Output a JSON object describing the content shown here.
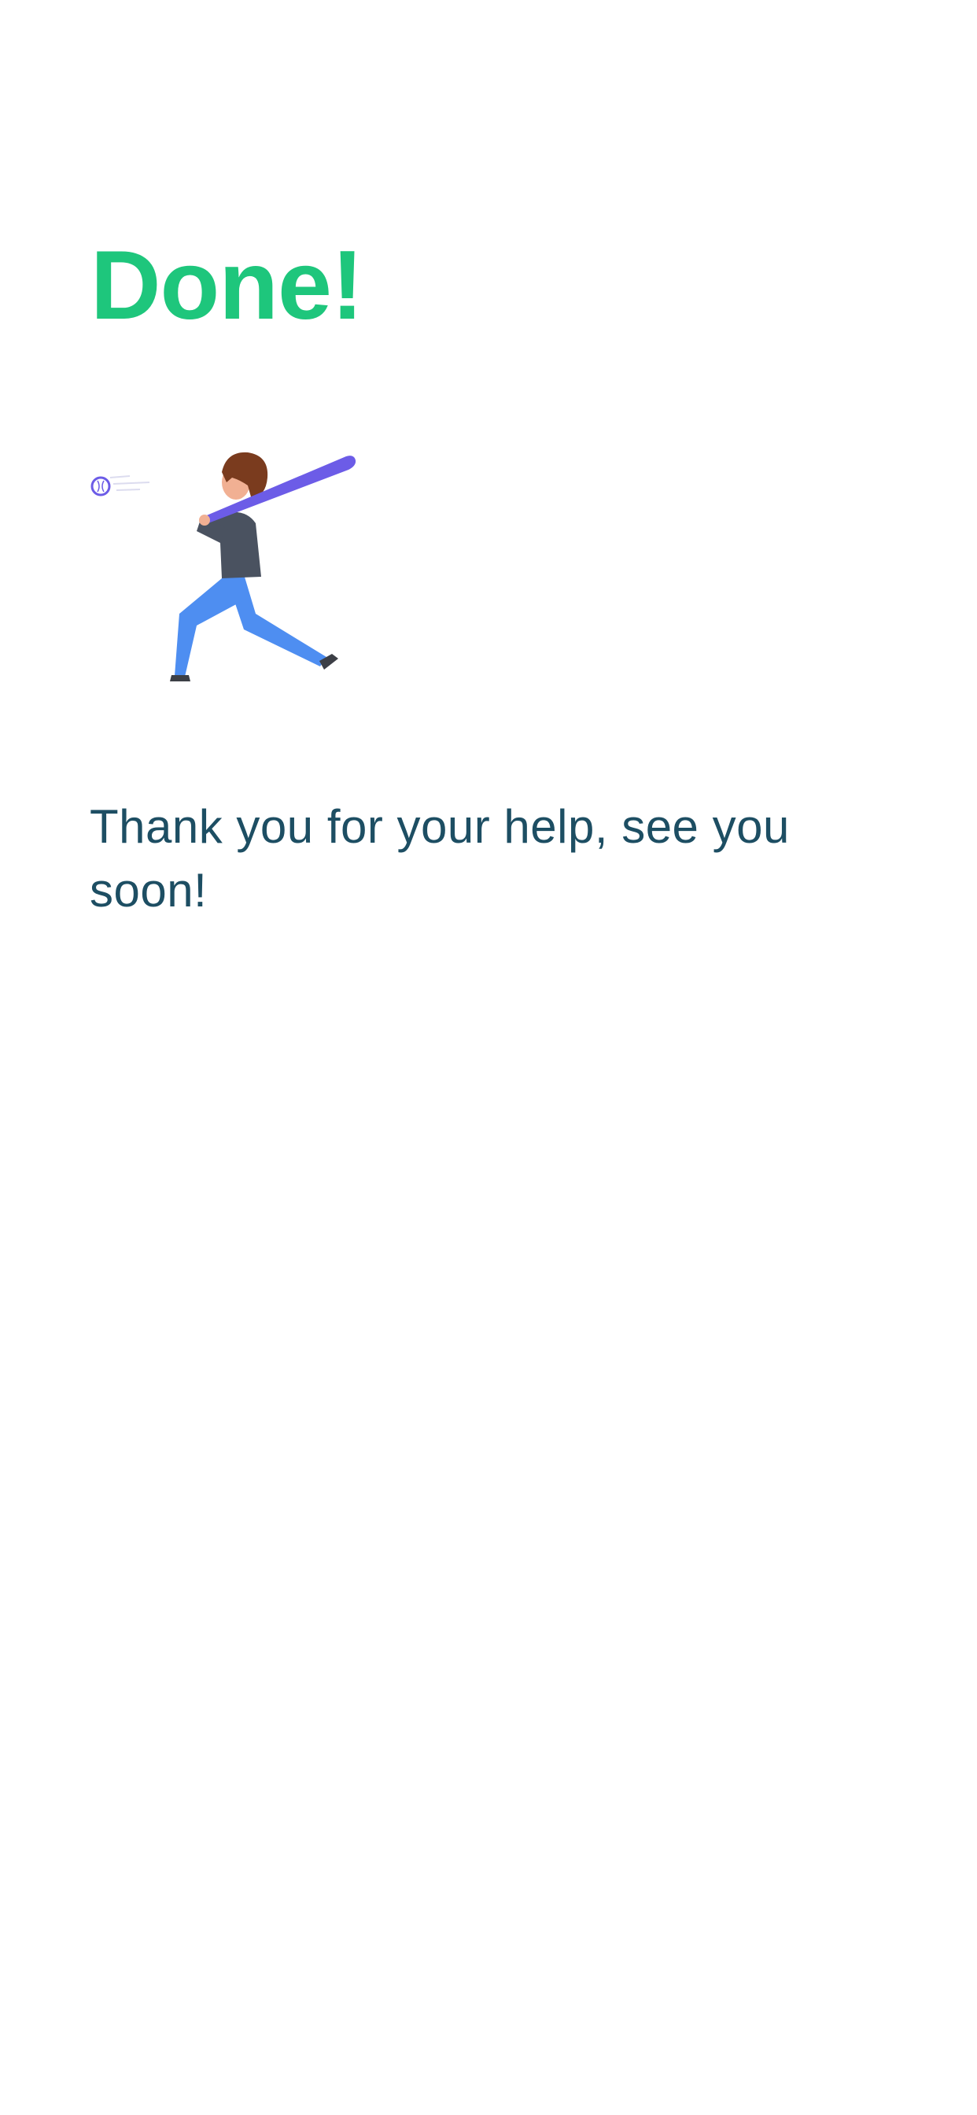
{
  "screen": {
    "title": "Done!",
    "message": "Thank you for your help, see you soon!",
    "illustration": "baseball-player-illustration"
  },
  "colors": {
    "background": "#ffffff",
    "title": "#1ec67c",
    "message": "#1d4e63",
    "bat": "#6c5ce7",
    "hair": "#7a3b1e",
    "skin": "#f1b093",
    "shirt": "#4a5260",
    "pants": "#4e8ef1",
    "shoes": "#3c3f46",
    "ball": "#6c5ce7"
  }
}
